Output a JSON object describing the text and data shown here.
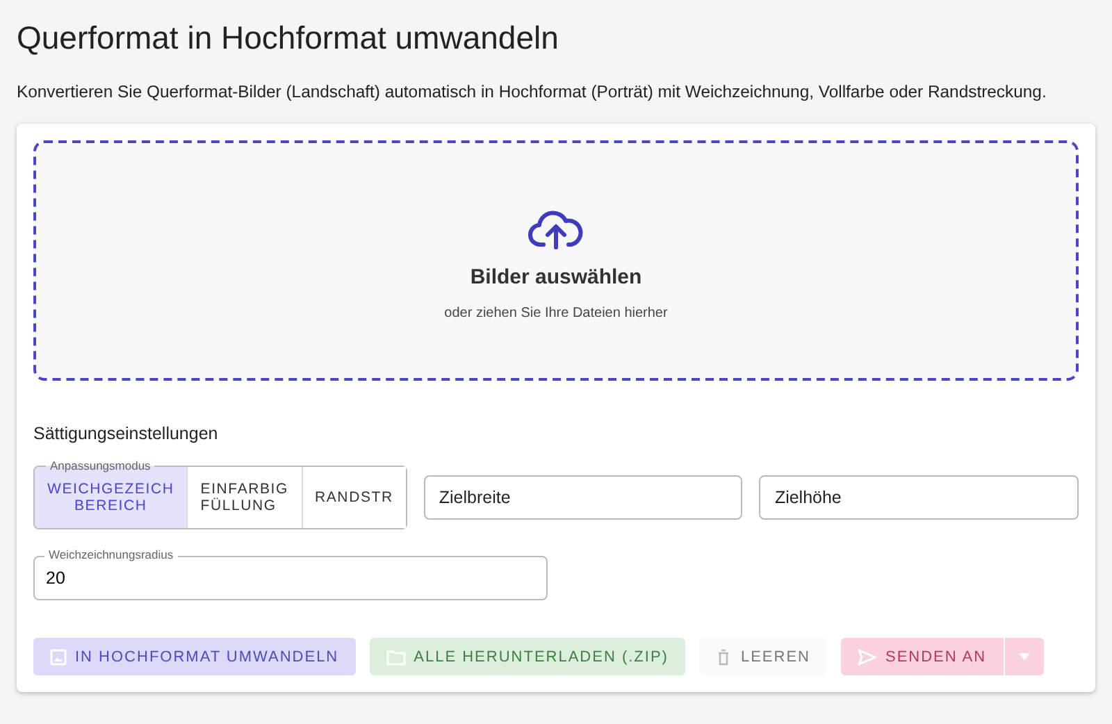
{
  "page": {
    "title": "Querformat in Hochformat umwandeln",
    "description": "Konvertieren Sie Querformat-Bilder (Landschaft) automatisch in Hochformat (Porträt) mit Weichzeichnung, Vollfarbe oder Randstreckung."
  },
  "dropzone": {
    "title": "Bilder auswählen",
    "hint": "oder ziehen Sie Ihre Dateien hierher"
  },
  "settings": {
    "heading": "Sättigungseinstellungen",
    "mode": {
      "label": "Anpassungsmodus",
      "options": [
        {
          "label": "WEICHGEZEICH BEREICH",
          "selected": true
        },
        {
          "label": "EINFARBIG FÜLLUNG",
          "selected": false
        },
        {
          "label": "RANDSTR",
          "selected": false
        }
      ]
    },
    "fields": [
      {
        "placeholder": "Zielbreite"
      },
      {
        "placeholder": "Zielhöhe"
      }
    ],
    "radius": {
      "label": "Weichzeichnungsradius",
      "value": "20"
    }
  },
  "actions": [
    {
      "kind": "convert",
      "label": "IN HOCHFORMAT UMWANDELN",
      "disabled": true
    },
    {
      "kind": "download",
      "label": "ALLE HERUNTERLADEN (.ZIP)",
      "disabled": true
    },
    {
      "kind": "clear",
      "label": "LEEREN",
      "disabled": true
    },
    {
      "kind": "send",
      "label": "SENDEN AN",
      "disabled": true
    }
  ]
}
